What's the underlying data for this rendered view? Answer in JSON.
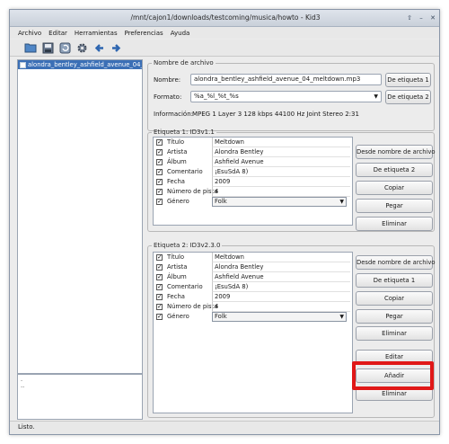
{
  "window": {
    "title": "/mnt/cajon1/downloads/testcoming/musica/howto - Kid3",
    "controls": [
      "⇧",
      "–",
      "✕"
    ]
  },
  "menu": [
    "Archivo",
    "Editar",
    "Herramientas",
    "Preferencias",
    "Ayuda"
  ],
  "toolbar": [
    "open-folder-icon",
    "save-icon",
    "revert-icon",
    "settings-icon",
    "previous-icon",
    "next-icon"
  ],
  "file_list": {
    "items": [
      "alondra_bentley_ashfield_avenue_04_meltdown.mp3"
    ]
  },
  "log": {
    "lines": [
      ".",
      ".."
    ]
  },
  "filename_group": {
    "legend": "Nombre de archivo",
    "name_label": "Nombre:",
    "name_value": "alondra_bentley_ashfield_avenue_04_meltdown.mp3",
    "format_label": "Formato:",
    "format_value": "%a_%l_%t_%s",
    "info_label": "Información:",
    "info_value": "MPEG 1 Layer 3 128 kbps 44100 Hz Joint Stereo 2:31",
    "btn_from_tag1": "De etiqueta 1",
    "btn_from_tag2": "De etiqueta 2"
  },
  "tag1": {
    "legend": "Etiqueta 1: ID3v1.1",
    "fields": [
      {
        "name": "Título",
        "value": "Meltdown"
      },
      {
        "name": "Artista",
        "value": "Alondra Bentley"
      },
      {
        "name": "Álbum",
        "value": "Ashfield Avenue"
      },
      {
        "name": "Comentario",
        "value": "¡EsuSdA 8)"
      },
      {
        "name": "Fecha",
        "value": "2009"
      },
      {
        "name": "Número de pista",
        "value": "4"
      }
    ],
    "genre": {
      "name": "Género",
      "value": "Folk"
    },
    "buttons": [
      "Desde nombre de archivo",
      "De etiqueta 2",
      "Copiar",
      "Pegar",
      "Eliminar"
    ]
  },
  "tag2": {
    "legend": "Etiqueta 2: ID3v2.3.0",
    "fields": [
      {
        "name": "Título",
        "value": "Meltdown"
      },
      {
        "name": "Artista",
        "value": "Alondra Bentley"
      },
      {
        "name": "Álbum",
        "value": "Ashfield Avenue"
      },
      {
        "name": "Comentario",
        "value": "¡EsuSdA 8)"
      },
      {
        "name": "Fecha",
        "value": "2009"
      },
      {
        "name": "Número de pista",
        "value": "4"
      }
    ],
    "genre": {
      "name": "Género",
      "value": "Folk"
    },
    "buttons": [
      "Desde nombre de archivo",
      "De etiqueta 1",
      "Copiar",
      "Pegar",
      "Eliminar"
    ],
    "extra_buttons": [
      "Editar",
      "Añadir",
      "Eliminar"
    ]
  },
  "status": {
    "text": "Listo."
  },
  "colors": {
    "highlight": "#e01818",
    "selection": "#3b6fb6"
  }
}
